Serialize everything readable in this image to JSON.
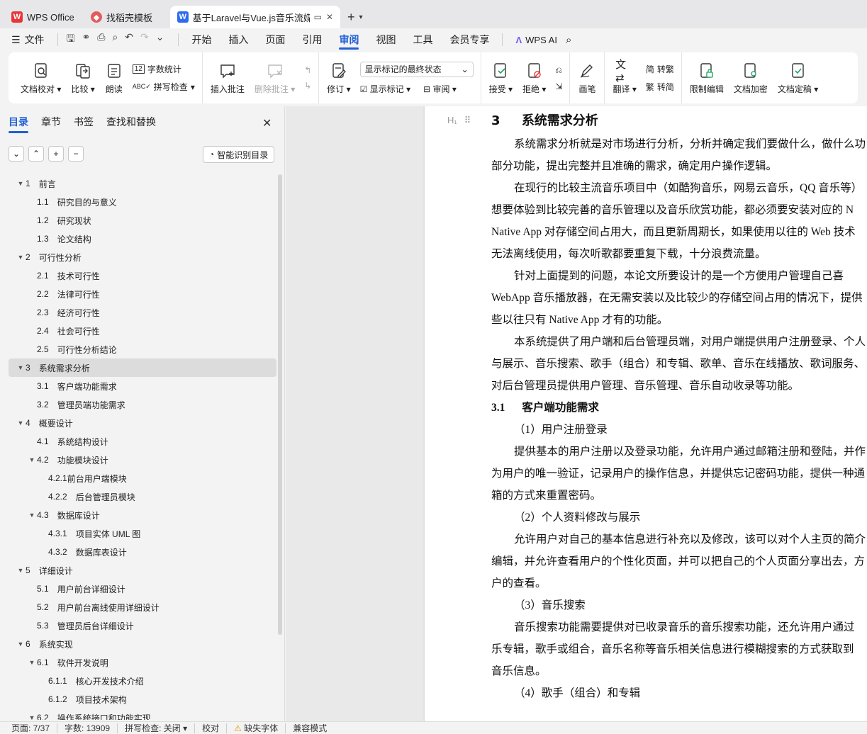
{
  "tabs": {
    "home": "WPS Office",
    "template": "找稻壳模板",
    "doc": "基于Laravel与Vue.js音乐流媒"
  },
  "menu": {
    "file": "文件",
    "items": [
      "开始",
      "插入",
      "页面",
      "引用",
      "审阅",
      "视图",
      "工具",
      "会员专享"
    ],
    "ai": "WPS AI"
  },
  "ribbon": {
    "doc_check": "文档校对",
    "compare": "比较",
    "read": "朗读",
    "word_count": "字数统计",
    "spell_check": "拼写检查",
    "insert_comment": "插入批注",
    "delete_comment": "删除批注",
    "revise": "修订",
    "markup_dropdown": "显示标记的最终状态",
    "show_markup": "显示标记",
    "review": "审阅",
    "accept": "接受",
    "reject": "拒绝",
    "pen": "画笔",
    "translate": "翻译",
    "to_traditional": "转繁",
    "to_simplified": "转简",
    "restrict_edit": "限制编辑",
    "encrypt": "文档加密",
    "finalize": "文档定稿"
  },
  "nav": {
    "tabs": [
      "目录",
      "章节",
      "书签",
      "查找和替换"
    ],
    "smart_toc": "智能识别目录",
    "toc": [
      {
        "num": "1",
        "label": "前言",
        "level": 1,
        "arrow": true
      },
      {
        "num": "1.1",
        "label": "研究目的与意义",
        "level": 2
      },
      {
        "num": "1.2",
        "label": "研究现状",
        "level": 2
      },
      {
        "num": "1.3",
        "label": "论文结构",
        "level": 2
      },
      {
        "num": "2",
        "label": "可行性分析",
        "level": 1,
        "arrow": true
      },
      {
        "num": "2.1",
        "label": "技术可行性",
        "level": 2
      },
      {
        "num": "2.2",
        "label": "法律可行性",
        "level": 2
      },
      {
        "num": "2.3",
        "label": "经济可行性",
        "level": 2
      },
      {
        "num": "2.4",
        "label": "社会可行性",
        "level": 2
      },
      {
        "num": "2.5",
        "label": "可行性分析结论",
        "level": 2
      },
      {
        "num": "3",
        "label": "系统需求分析",
        "level": 1,
        "arrow": true,
        "selected": true
      },
      {
        "num": "3.1",
        "label": "客户端功能需求",
        "level": 2
      },
      {
        "num": "3.2",
        "label": "管理员端功能需求",
        "level": 2
      },
      {
        "num": "4",
        "label": "概要设计",
        "level": 1,
        "arrow": true
      },
      {
        "num": "4.1",
        "label": "系统结构设计",
        "level": 2
      },
      {
        "num": "4.2",
        "label": "功能模块设计",
        "level": 2,
        "arrow": true
      },
      {
        "num": "4.2.1",
        "label": "前台用户端模块",
        "level": 3,
        "tight": true
      },
      {
        "num": "4.2.2",
        "label": "后台管理员模块",
        "level": 3
      },
      {
        "num": "4.3",
        "label": "数据库设计",
        "level": 2,
        "arrow": true
      },
      {
        "num": "4.3.1",
        "label": "项目实体 UML 图",
        "level": 3
      },
      {
        "num": "4.3.2",
        "label": "数据库表设计",
        "level": 3
      },
      {
        "num": "5",
        "label": "详细设计",
        "level": 1,
        "arrow": true
      },
      {
        "num": "5.1",
        "label": "用户前台详细设计",
        "level": 2
      },
      {
        "num": "5.2",
        "label": "用户前台离线使用详细设计",
        "level": 2
      },
      {
        "num": "5.3",
        "label": "管理员后台详细设计",
        "level": 2
      },
      {
        "num": "6",
        "label": "系统实现",
        "level": 1,
        "arrow": true
      },
      {
        "num": "6.1",
        "label": "软件开发说明",
        "level": 2,
        "arrow": true
      },
      {
        "num": "6.1.1",
        "label": "核心开发技术介绍",
        "level": 3
      },
      {
        "num": "6.1.2",
        "label": "项目技术架构",
        "level": 3
      },
      {
        "num": "6.2",
        "label": "操作系统接口和功能实现",
        "level": 2,
        "arrow": true
      }
    ]
  },
  "document": {
    "heading": {
      "num": "3",
      "text": "系统需求分析"
    },
    "lines": [
      {
        "type": "p",
        "indent": true,
        "text": "系统需求分析就是对市场进行分析，分析并确定我们要做什么，做什么功"
      },
      {
        "type": "p",
        "indent": false,
        "text": "部分功能，提出完整并且准确的需求，确定用户操作逻辑。"
      },
      {
        "type": "p",
        "indent": true,
        "text": "在现行的比较主流音乐项目中（如酷狗音乐，网易云音乐，QQ 音乐等）"
      },
      {
        "type": "p",
        "indent": false,
        "text": "想要体验到比较完善的音乐管理以及音乐欣赏功能，都必须要安装对应的 N"
      },
      {
        "type": "p",
        "indent": false,
        "text": "Native App 对存储空间占用大，而且更新周期长，如果使用以往的 Web 技术"
      },
      {
        "type": "p",
        "indent": false,
        "text": "无法离线使用，每次听歌都要重复下载，十分浪费流量。"
      },
      {
        "type": "p",
        "indent": true,
        "text": "针对上面提到的问题，本论文所要设计的是一个方便用户管理自己喜"
      },
      {
        "type": "p",
        "indent": false,
        "text": "WebApp 音乐播放器，在无需安装以及比较少的存储空间占用的情况下，提供"
      },
      {
        "type": "p",
        "indent": false,
        "text": "些以往只有 Native App 才有的功能。"
      },
      {
        "type": "p",
        "indent": true,
        "text": "本系统提供了用户端和后台管理员端，对用户端提供用户注册登录、个人"
      },
      {
        "type": "p",
        "indent": false,
        "text": "与展示、音乐搜索、歌手（组合）和专辑、歌单、音乐在线播放、歌词服务、"
      },
      {
        "type": "p",
        "indent": false,
        "text": "对后台管理员提供用户管理、音乐管理、音乐自动收录等功能。"
      },
      {
        "type": "h2",
        "num": "3.1",
        "text": "客户端功能需求"
      },
      {
        "type": "p",
        "indent": true,
        "text": "（1）用户注册登录"
      },
      {
        "type": "p",
        "indent": true,
        "text": "提供基本的用户注册以及登录功能，允许用户通过邮箱注册和登陆，并作"
      },
      {
        "type": "p",
        "indent": false,
        "text": "为用户的唯一验证，记录用户的操作信息，并提供忘记密码功能，提供一种通"
      },
      {
        "type": "p",
        "indent": false,
        "text": "箱的方式来重置密码。"
      },
      {
        "type": "p",
        "indent": true,
        "text": "（2）个人资料修改与展示"
      },
      {
        "type": "p",
        "indent": true,
        "text": "允许用户对自己的基本信息进行补充以及修改，该可以对个人主页的简介"
      },
      {
        "type": "p",
        "indent": false,
        "text": "编辑，并允许查看用户的个性化页面，并可以把自己的个人页面分享出去，方"
      },
      {
        "type": "p",
        "indent": false,
        "text": "户的查看。"
      },
      {
        "type": "p",
        "indent": true,
        "text": "（3）音乐搜索"
      },
      {
        "type": "p",
        "indent": true,
        "text": "音乐搜索功能需要提供对已收录音乐的音乐搜索功能，还允许用户通过"
      },
      {
        "type": "p",
        "indent": false,
        "text": "乐专辑，歌手或组合，音乐名称等音乐相关信息进行模糊搜索的方式获取到"
      },
      {
        "type": "p",
        "indent": false,
        "text": "音乐信息。"
      },
      {
        "type": "p",
        "indent": true,
        "text": "（4）歌手（组合）和专辑"
      }
    ]
  },
  "status": {
    "page": "页面: 7/37",
    "words": "字数: 13909",
    "spell": "拼写检查: 关闭",
    "proof": "校对",
    "missing_font": "缺失字体",
    "compat": "兼容模式"
  },
  "colors": {
    "accent": "#1f5fd6",
    "wps_red": "#e8353a"
  }
}
